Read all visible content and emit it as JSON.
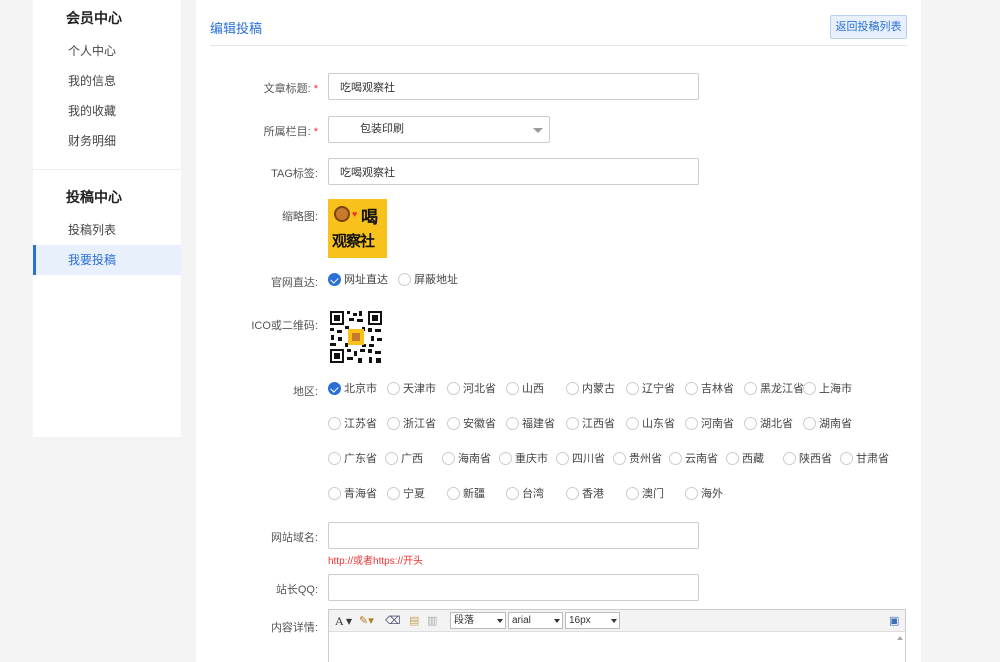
{
  "sidebar": {
    "member_title": "会员中心",
    "member_items": [
      "个人中心",
      "我的信息",
      "我的收藏",
      "财务明细"
    ],
    "submit_title": "投稿中心",
    "submit_items": [
      "投稿列表",
      "我要投稿"
    ]
  },
  "header": {
    "title": "编辑投稿",
    "back_label": "返回投稿列表"
  },
  "form": {
    "title_label": "文章标题:",
    "title_value": "吃喝观察社",
    "category_label": "所属栏目:",
    "category_value": "包装印刷",
    "tag_label": "TAG标签:",
    "tag_value": "吃喝观察社",
    "thumb_label": "缩略图:",
    "thumb_text_1": "喝",
    "thumb_text_2": "观察社",
    "direct_label": "官网直达:",
    "direct_options": [
      "网址直达",
      "屏蔽地址"
    ],
    "direct_selected": "网址直达",
    "qr_label": "ICO或二维码:",
    "region_label": "地区:",
    "regions": [
      "北京市",
      "天津市",
      "河北省",
      "山西",
      "内蒙古",
      "辽宁省",
      "吉林省",
      "黑龙江省",
      "上海市",
      "江苏省",
      "浙江省",
      "安徽省",
      "福建省",
      "江西省",
      "山东省",
      "河南省",
      "湖北省",
      "湖南省",
      "广东省",
      "广西",
      "海南省",
      "重庆市",
      "四川省",
      "贵州省",
      "云南省",
      "西藏",
      "陕西省",
      "甘肃省",
      "青海省",
      "宁夏",
      "新疆",
      "台湾",
      "香港",
      "澳门",
      "海外"
    ],
    "region_selected": "北京市",
    "domain_label": "网站域名:",
    "domain_value": "",
    "domain_hint": "http://或者https://开头",
    "qq_label": "站长QQ:",
    "qq_value": "",
    "content_label": "内容详情:"
  },
  "editor": {
    "font_glyph": "A",
    "paragraph": "段落",
    "font": "arial",
    "size": "16px"
  },
  "colors": {
    "accent": "#2a6fd6",
    "required": "#e33333",
    "thumb_bg": "#f9c11b"
  }
}
